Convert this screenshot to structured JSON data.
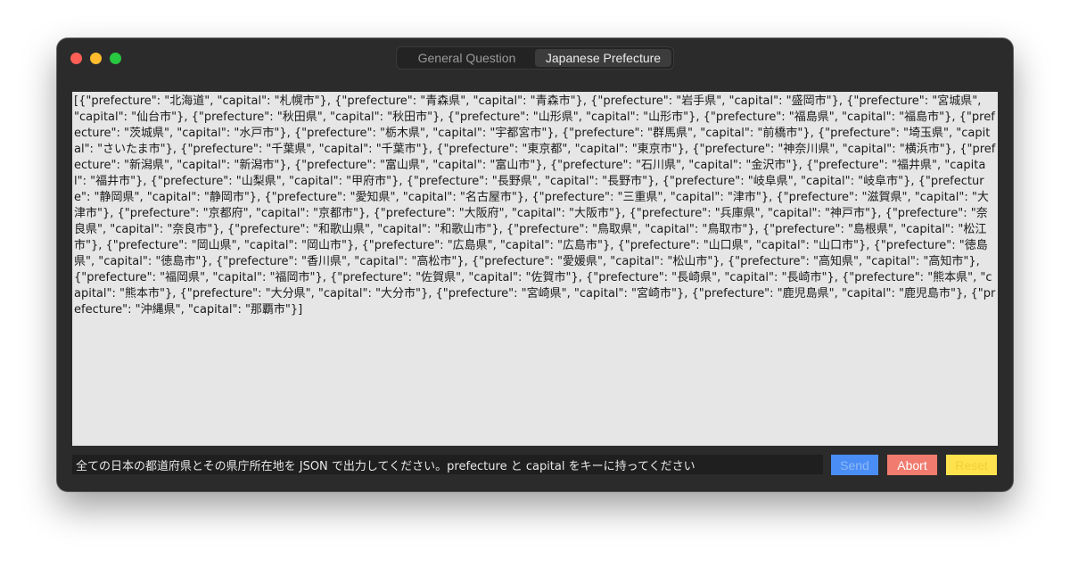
{
  "window": {
    "tabs": [
      {
        "label": "General Question",
        "active": false
      },
      {
        "label": "Japanese Prefecture",
        "active": true
      }
    ]
  },
  "output": {
    "text": "[{\"prefecture\": \"北海道\", \"capital\": \"札幌市\"}, {\"prefecture\": \"青森県\", \"capital\": \"青森市\"}, {\"prefecture\": \"岩手県\", \"capital\": \"盛岡市\"}, {\"prefecture\": \"宮城県\", \"capital\": \"仙台市\"}, {\"prefecture\": \"秋田県\", \"capital\": \"秋田市\"}, {\"prefecture\": \"山形県\", \"capital\": \"山形市\"}, {\"prefecture\": \"福島県\", \"capital\": \"福島市\"}, {\"prefecture\": \"茨城県\", \"capital\": \"水戸市\"}, {\"prefecture\": \"栃木県\", \"capital\": \"宇都宮市\"}, {\"prefecture\": \"群馬県\", \"capital\": \"前橋市\"}, {\"prefecture\": \"埼玉県\", \"capital\": \"さいたま市\"}, {\"prefecture\": \"千葉県\", \"capital\": \"千葉市\"}, {\"prefecture\": \"東京都\", \"capital\": \"東京市\"}, {\"prefecture\": \"神奈川県\", \"capital\": \"横浜市\"}, {\"prefecture\": \"新潟県\", \"capital\": \"新潟市\"}, {\"prefecture\": \"富山県\", \"capital\": \"富山市\"}, {\"prefecture\": \"石川県\", \"capital\": \"金沢市\"}, {\"prefecture\": \"福井県\", \"capital\": \"福井市\"}, {\"prefecture\": \"山梨県\", \"capital\": \"甲府市\"}, {\"prefecture\": \"長野県\", \"capital\": \"長野市\"}, {\"prefecture\": \"岐阜県\", \"capital\": \"岐阜市\"}, {\"prefecture\": \"静岡県\", \"capital\": \"静岡市\"}, {\"prefecture\": \"愛知県\", \"capital\": \"名古屋市\"}, {\"prefecture\": \"三重県\", \"capital\": \"津市\"}, {\"prefecture\": \"滋賀県\", \"capital\": \"大津市\"}, {\"prefecture\": \"京都府\", \"capital\": \"京都市\"}, {\"prefecture\": \"大阪府\", \"capital\": \"大阪市\"}, {\"prefecture\": \"兵庫県\", \"capital\": \"神戸市\"}, {\"prefecture\": \"奈良県\", \"capital\": \"奈良市\"}, {\"prefecture\": \"和歌山県\", \"capital\": \"和歌山市\"}, {\"prefecture\": \"鳥取県\", \"capital\": \"鳥取市\"}, {\"prefecture\": \"島根県\", \"capital\": \"松江市\"}, {\"prefecture\": \"岡山県\", \"capital\": \"岡山市\"}, {\"prefecture\": \"広島県\", \"capital\": \"広島市\"}, {\"prefecture\": \"山口県\", \"capital\": \"山口市\"}, {\"prefecture\": \"徳島県\", \"capital\": \"徳島市\"}, {\"prefecture\": \"香川県\", \"capital\": \"高松市\"}, {\"prefecture\": \"愛媛県\", \"capital\": \"松山市\"}, {\"prefecture\": \"高知県\", \"capital\": \"高知市\"}, {\"prefecture\": \"福岡県\", \"capital\": \"福岡市\"}, {\"prefecture\": \"佐賀県\", \"capital\": \"佐賀市\"}, {\"prefecture\": \"長崎県\", \"capital\": \"長崎市\"}, {\"prefecture\": \"熊本県\", \"capital\": \"熊本市\"}, {\"prefecture\": \"大分県\", \"capital\": \"大分市\"}, {\"prefecture\": \"宮崎県\", \"capital\": \"宮崎市\"}, {\"prefecture\": \"鹿児島県\", \"capital\": \"鹿児島市\"}, {\"prefecture\": \"沖縄県\", \"capital\": \"那覇市\"}]"
  },
  "prompt": {
    "value": "全ての日本の都道府県とその県庁所在地を JSON で出力してください。prefecture と capital をキーに持ってください"
  },
  "buttons": {
    "send": "Send",
    "abort": "Abort",
    "reset": "Reset"
  },
  "colors": {
    "traffic_close": "#ff5f57",
    "traffic_minimize": "#febc2e",
    "traffic_maximize": "#28c840",
    "send": "#4a8ef5",
    "abort": "#f07b6e",
    "reset": "#ffe24d"
  }
}
